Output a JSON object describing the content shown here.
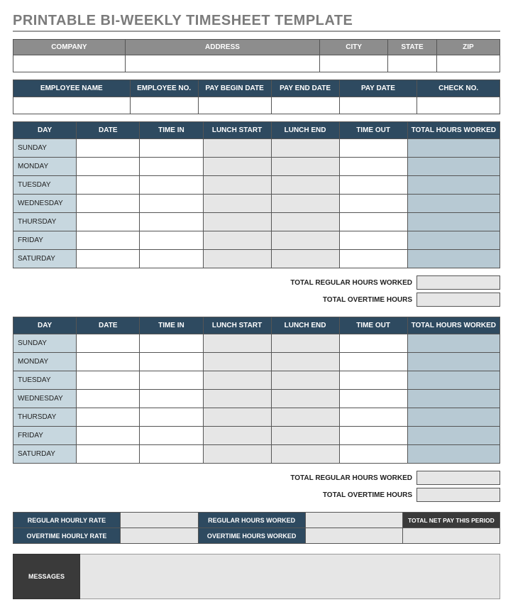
{
  "title": "PRINTABLE BI-WEEKLY TIMESHEET TEMPLATE",
  "company_headers": [
    "COMPANY",
    "ADDRESS",
    "CITY",
    "STATE",
    "ZIP"
  ],
  "company_values": [
    "",
    "",
    "",
    "",
    ""
  ],
  "employee_headers": [
    "EMPLOYEE NAME",
    "EMPLOYEE NO.",
    "PAY BEGIN DATE",
    "PAY END DATE",
    "PAY DATE",
    "CHECK NO."
  ],
  "employee_values": [
    "",
    "",
    "",
    "",
    "",
    ""
  ],
  "week_headers": [
    "DAY",
    "DATE",
    "TIME IN",
    "LUNCH START",
    "LUNCH END",
    "TIME OUT",
    "TOTAL HOURS WORKED"
  ],
  "days": [
    "SUNDAY",
    "MONDAY",
    "TUESDAY",
    "WEDNESDAY",
    "THURSDAY",
    "FRIDAY",
    "SATURDAY"
  ],
  "subtotals": {
    "regular_label": "TOTAL REGULAR HOURS WORKED",
    "overtime_label": "TOTAL OVERTIME HOURS",
    "regular_value": "",
    "overtime_value": ""
  },
  "pay": {
    "regular_rate_label": "REGULAR HOURLY RATE",
    "overtime_rate_label": "OVERTIME HOURLY RATE",
    "regular_hours_label": "REGULAR HOURS WORKED",
    "overtime_hours_label": "OVERTIME HOURS WORKED",
    "net_pay_label": "TOTAL NET PAY THIS PERIOD",
    "regular_rate": "",
    "overtime_rate": "",
    "regular_hours": "",
    "overtime_hours": "",
    "net_pay": ""
  },
  "messages_label": "MESSAGES",
  "messages_value": ""
}
